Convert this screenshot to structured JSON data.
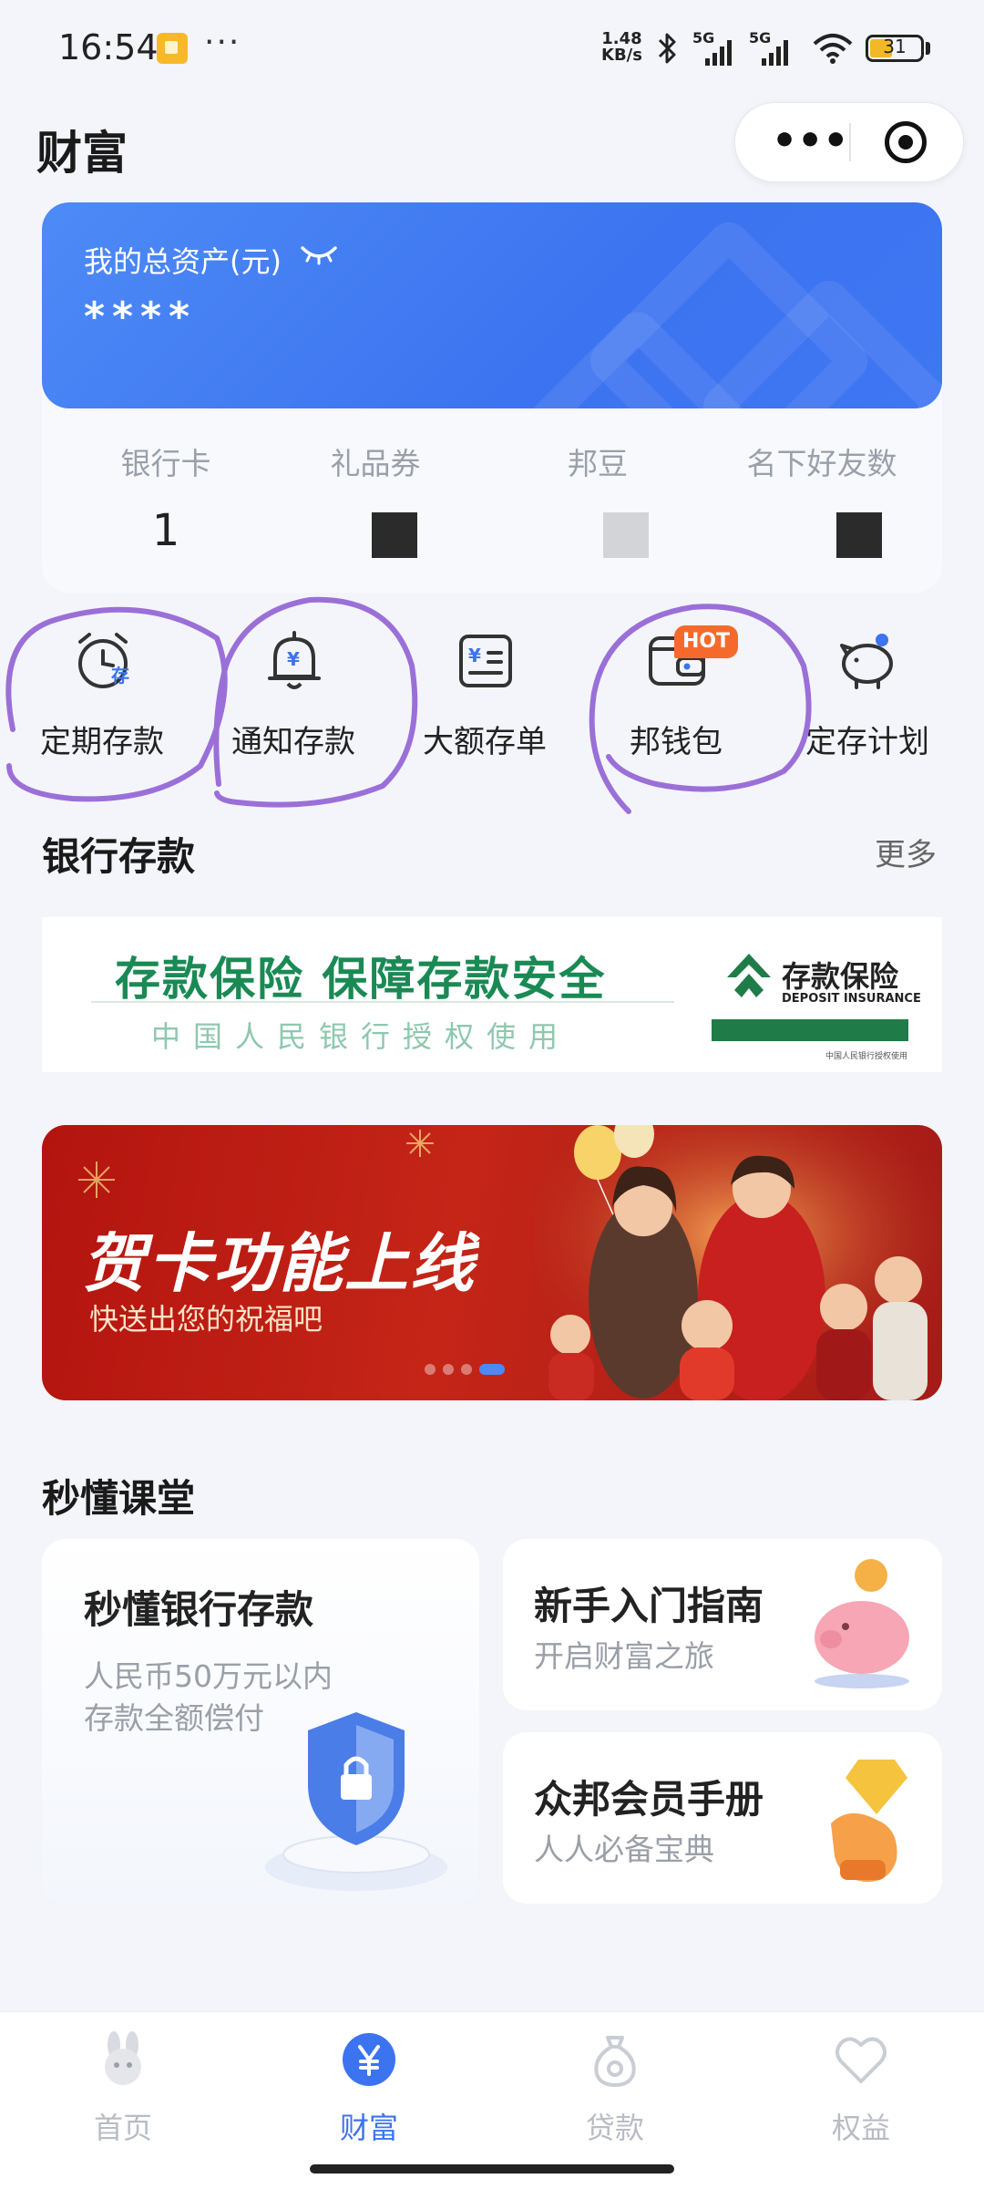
{
  "status_bar": {
    "time": "16:54",
    "dots": "···",
    "net_speed_top": "1.48",
    "net_speed_bottom": "KB/s",
    "signal1": "5G",
    "signal2": "5G",
    "battery": "31"
  },
  "header": {
    "title": "财富",
    "more_label": "•••"
  },
  "assets": {
    "label": "我的总资产(元)",
    "value": "****"
  },
  "stats": [
    {
      "label": "银行卡",
      "value": "1"
    },
    {
      "label": "礼品券",
      "value": ""
    },
    {
      "label": "邦豆",
      "value": ""
    },
    {
      "label": "名下好友数",
      "value": ""
    }
  ],
  "quick_actions": [
    {
      "label": "定期存款",
      "icon": "alarm-clock-icon",
      "icon_text": "存"
    },
    {
      "label": "通知存款",
      "icon": "bell-icon",
      "icon_text": "¥"
    },
    {
      "label": "大额存单",
      "icon": "certificate-icon",
      "icon_text": "¥"
    },
    {
      "label": "邦钱包",
      "icon": "wallet-icon",
      "badge": "HOT"
    },
    {
      "label": "定存计划",
      "icon": "piggy-bank-icon"
    }
  ],
  "bank_deposit": {
    "title": "银行存款",
    "more": "更多"
  },
  "insurance_banner": {
    "title": "存款保险  保障存款安全",
    "subtitle": "中国人民银行授权使用",
    "logo_cn": "存款保险",
    "logo_en": "DEPOSIT INSURANCE",
    "logo_small": "中国人民银行授权使用"
  },
  "promo_banner": {
    "title": "贺卡功能上线",
    "subtitle": "快送出您的祝福吧"
  },
  "classroom": {
    "title": "秒懂课堂",
    "cards": [
      {
        "title": "秒懂银行存款",
        "sub1": "人民币50万元以内",
        "sub2": "存款全额偿付"
      },
      {
        "title": "新手入门指南",
        "sub1": "开启财富之旅"
      },
      {
        "title": "众邦会员手册",
        "sub1": "人人必备宝典"
      }
    ]
  },
  "tabs": [
    {
      "label": "首页",
      "icon": "rabbit-icon",
      "active": false
    },
    {
      "label": "财富",
      "icon": "yuan-icon",
      "active": true
    },
    {
      "label": "贷款",
      "icon": "money-bag-icon",
      "active": false
    },
    {
      "label": "权益",
      "icon": "heart-icon",
      "active": false
    }
  ],
  "colors": {
    "primary": "#3c73f0",
    "annotation": "#9b6fd8",
    "hot": "#f56a2c",
    "insurance_green": "#1a8a55",
    "promo_red": "#b3140f"
  }
}
